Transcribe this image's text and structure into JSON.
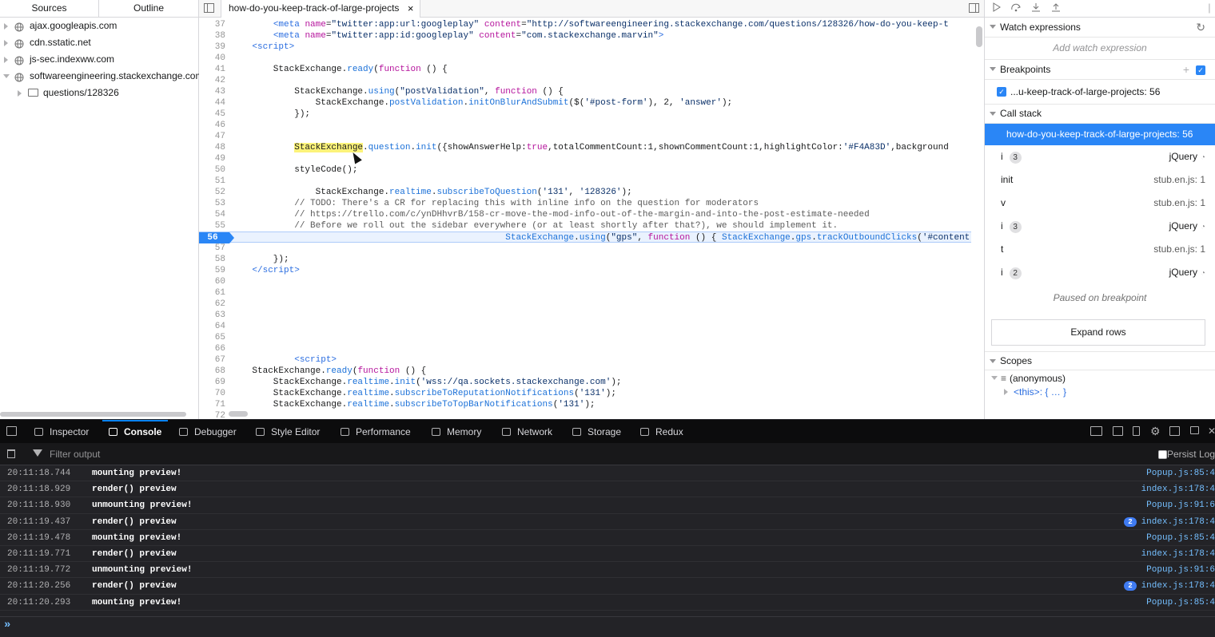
{
  "sources": {
    "tabs": [
      "Sources",
      "Outline"
    ],
    "tree": [
      {
        "label": "ajax.googleapis.com",
        "kind": "domain",
        "expanded": false
      },
      {
        "label": "cdn.sstatic.net",
        "kind": "domain",
        "expanded": false
      },
      {
        "label": "js-sec.indexww.com",
        "kind": "domain",
        "expanded": false
      },
      {
        "label": "softwareengineering.stackexchange.com",
        "kind": "domain",
        "expanded": true
      },
      {
        "label": "questions/128326",
        "kind": "folder",
        "expanded": false
      }
    ]
  },
  "editor": {
    "tab_label": "how-do-you-keep-track-of-large-projects",
    "tab_close": "×",
    "breakpoint_line": 56,
    "lines": [
      {
        "n": "37",
        "html": "        <span class=\"tg\">&lt;meta</span> <span class=\"kw\">name</span>=<span class=\"st\">\"twitter:app:url:googleplay\"</span> <span class=\"kw\">content</span>=<span class=\"st\">\"http://softwareengineering.stackexchange.com/questions/128326/how-do-you-keep-t</span>"
      },
      {
        "n": "38",
        "html": "        <span class=\"tg\">&lt;meta</span> <span class=\"kw\">name</span>=<span class=\"st\">\"twitter:app:id:googleplay\"</span> <span class=\"kw\">content</span>=<span class=\"st\">\"com.stackexchange.marvin\"</span><span class=\"tg\">&gt;</span>"
      },
      {
        "n": "39",
        "html": "    <span class=\"tg\">&lt;script&gt;</span>"
      },
      {
        "n": "40",
        "html": ""
      },
      {
        "n": "41",
        "html": "        StackExchange.<span class=\"pr\">ready</span>(<span class=\"kw\">function</span> () {"
      },
      {
        "n": "42",
        "html": ""
      },
      {
        "n": "43",
        "html": "            StackExchange.<span class=\"pr\">using</span>(<span class=\"st\">\"postValidation\"</span>, <span class=\"kw\">function</span> () {"
      },
      {
        "n": "44",
        "html": "                StackExchange.<span class=\"pr\">postValidation</span>.<span class=\"pr\">initOnBlurAndSubmit</span>($(<span class=\"st\">'#post-form'</span>), 2, <span class=\"st\">'answer'</span>);"
      },
      {
        "n": "45",
        "html": "            });"
      },
      {
        "n": "46",
        "html": ""
      },
      {
        "n": "47",
        "html": ""
      },
      {
        "n": "48",
        "html": "            <span class=\"hl\">StackExchange</span>.<span class=\"pr\">question</span>.<span class=\"pr\">init</span>({showAnswerHelp:<span class=\"kw\">true</span>,totalCommentCount:1,shownCommentCount:1,highlightColor:<span class=\"st\">'#F4A83D'</span>,background"
      },
      {
        "n": "49",
        "html": ""
      },
      {
        "n": "50",
        "html": "            styleCode();"
      },
      {
        "n": "51",
        "html": ""
      },
      {
        "n": "52",
        "html": "                StackExchange.<span class=\"pr\">realtime</span>.<span class=\"pr\">subscribeToQuestion</span>(<span class=\"st\">'131'</span>, <span class=\"st\">'128326'</span>);"
      },
      {
        "n": "53",
        "html": "            <span class=\"cm\">// TODO: There's a CR for replacing this with inline info on the question for moderators</span>"
      },
      {
        "n": "54",
        "html": "            <span class=\"cm\">// https://trello.com/c/ynDHhvrB/158-cr-move-the-mod-info-out-of-the-margin-and-into-the-post-estimate-needed</span>"
      },
      {
        "n": "55",
        "html": "            <span class=\"cm\">// Before we roll out the sidebar everywhere (or at least shortly after that?), we should implement it.</span>"
      },
      {
        "n": "56",
        "html": "                                                    <span class=\"pr\">StackExchange</span>.<span class=\"pr\">using</span>(<span class=\"st\">\"gps\"</span>, <span class=\"kw\">function</span> () { <span class=\"pr\">StackExchange</span>.<span class=\"pr\">gps</span>.<span class=\"pr\">trackOutboundClicks</span>(<span class=\"st\">'#content</span>"
      },
      {
        "n": "57",
        "html": ""
      },
      {
        "n": "58",
        "html": "        });"
      },
      {
        "n": "59",
        "html": "    <span class=\"tg\">&lt;/script&gt;</span>"
      },
      {
        "n": "60",
        "html": ""
      },
      {
        "n": "61",
        "html": ""
      },
      {
        "n": "62",
        "html": ""
      },
      {
        "n": "63",
        "html": ""
      },
      {
        "n": "64",
        "html": ""
      },
      {
        "n": "65",
        "html": ""
      },
      {
        "n": "66",
        "html": ""
      },
      {
        "n": "67",
        "html": "            <span class=\"tg\">&lt;script&gt;</span>"
      },
      {
        "n": "68",
        "html": "    StackExchange.<span class=\"pr\">ready</span>(<span class=\"kw\">function</span> () {"
      },
      {
        "n": "69",
        "html": "        StackExchange.<span class=\"pr\">realtime</span>.<span class=\"pr\">init</span>(<span class=\"st\">'wss://qa.sockets.stackexchange.com'</span>);"
      },
      {
        "n": "70",
        "html": "        StackExchange.<span class=\"pr\">realtime</span>.<span class=\"pr\">subscribeToReputationNotifications</span>(<span class=\"st\">'131'</span>);"
      },
      {
        "n": "71",
        "html": "        StackExchange.<span class=\"pr\">realtime</span>.<span class=\"pr\">subscribeToTopBarNotifications</span>(<span class=\"st\">'131'</span>);"
      },
      {
        "n": "72",
        "html": ""
      }
    ]
  },
  "debugger": {
    "watch": {
      "title": "Watch expressions",
      "placeholder": "Add watch expression"
    },
    "breakpoints": {
      "title": "Breakpoints",
      "item": "...u-keep-track-of-large-projects: 56"
    },
    "call_stack": {
      "title": "Call stack",
      "frames": [
        {
          "name": "how-do-you-keep-track-of-large-projects: 56",
          "selected": true,
          "loc": "",
          "badge": "",
          "lib": ""
        },
        {
          "name": "i",
          "badge": "3",
          "lib": "jQuery",
          "loc": ""
        },
        {
          "name": "init",
          "badge": "",
          "lib": "",
          "loc": "stub.en.js: 1"
        },
        {
          "name": "v",
          "badge": "",
          "lib": "",
          "loc": "stub.en.js: 1"
        },
        {
          "name": "i",
          "badge": "3",
          "lib": "jQuery",
          "loc": ""
        },
        {
          "name": "t",
          "badge": "",
          "lib": "",
          "loc": "stub.en.js: 1"
        },
        {
          "name": "i",
          "badge": "2",
          "lib": "jQuery",
          "loc": ""
        }
      ],
      "paused": "Paused on breakpoint",
      "expand": "Expand rows"
    },
    "scopes": {
      "title": "Scopes",
      "anon": "(anonymous)",
      "this": "<this>: { … }"
    }
  },
  "toolbar": {
    "tabs": [
      {
        "label": "Inspector",
        "icon": "inspector-icon"
      },
      {
        "label": "Console",
        "icon": "console-icon",
        "active": true
      },
      {
        "label": "Debugger",
        "icon": "debugger-icon"
      },
      {
        "label": "Style Editor",
        "icon": "style-editor-icon"
      },
      {
        "label": "Performance",
        "icon": "performance-icon"
      },
      {
        "label": "Memory",
        "icon": "memory-icon"
      },
      {
        "label": "Network",
        "icon": "network-icon"
      },
      {
        "label": "Storage",
        "icon": "storage-icon"
      },
      {
        "label": "Redux",
        "icon": "redux-icon"
      }
    ]
  },
  "console": {
    "filter_placeholder": "Filter output",
    "persist_label": "Persist Log",
    "messages": [
      {
        "time": "20:11:18.744",
        "text": "mounting preview!",
        "src": "Popup.js:85:4",
        "repeat": ""
      },
      {
        "time": "20:11:18.929",
        "text": "render() preview",
        "src": "index.js:178:4",
        "repeat": ""
      },
      {
        "time": "20:11:18.930",
        "text": "unmounting preview!",
        "src": "Popup.js:91:6",
        "repeat": ""
      },
      {
        "time": "20:11:19.437",
        "text": "render() preview",
        "src": "index.js:178:4",
        "repeat": "2"
      },
      {
        "time": "20:11:19.478",
        "text": "mounting preview!",
        "src": "Popup.js:85:4",
        "repeat": ""
      },
      {
        "time": "20:11:19.771",
        "text": "render() preview",
        "src": "index.js:178:4",
        "repeat": ""
      },
      {
        "time": "20:11:19.772",
        "text": "unmounting preview!",
        "src": "Popup.js:91:6",
        "repeat": ""
      },
      {
        "time": "20:11:20.256",
        "text": "render() preview",
        "src": "index.js:178:4",
        "repeat": "2"
      },
      {
        "time": "20:11:20.293",
        "text": "mounting preview!",
        "src": "Popup.js:85:4",
        "repeat": ""
      }
    ],
    "prompt": "»"
  },
  "colors": {
    "accent": "#2a86f6",
    "toolbar_bg": "#0c0c0d",
    "console_bg": "#232327",
    "link": "#75bfff"
  }
}
